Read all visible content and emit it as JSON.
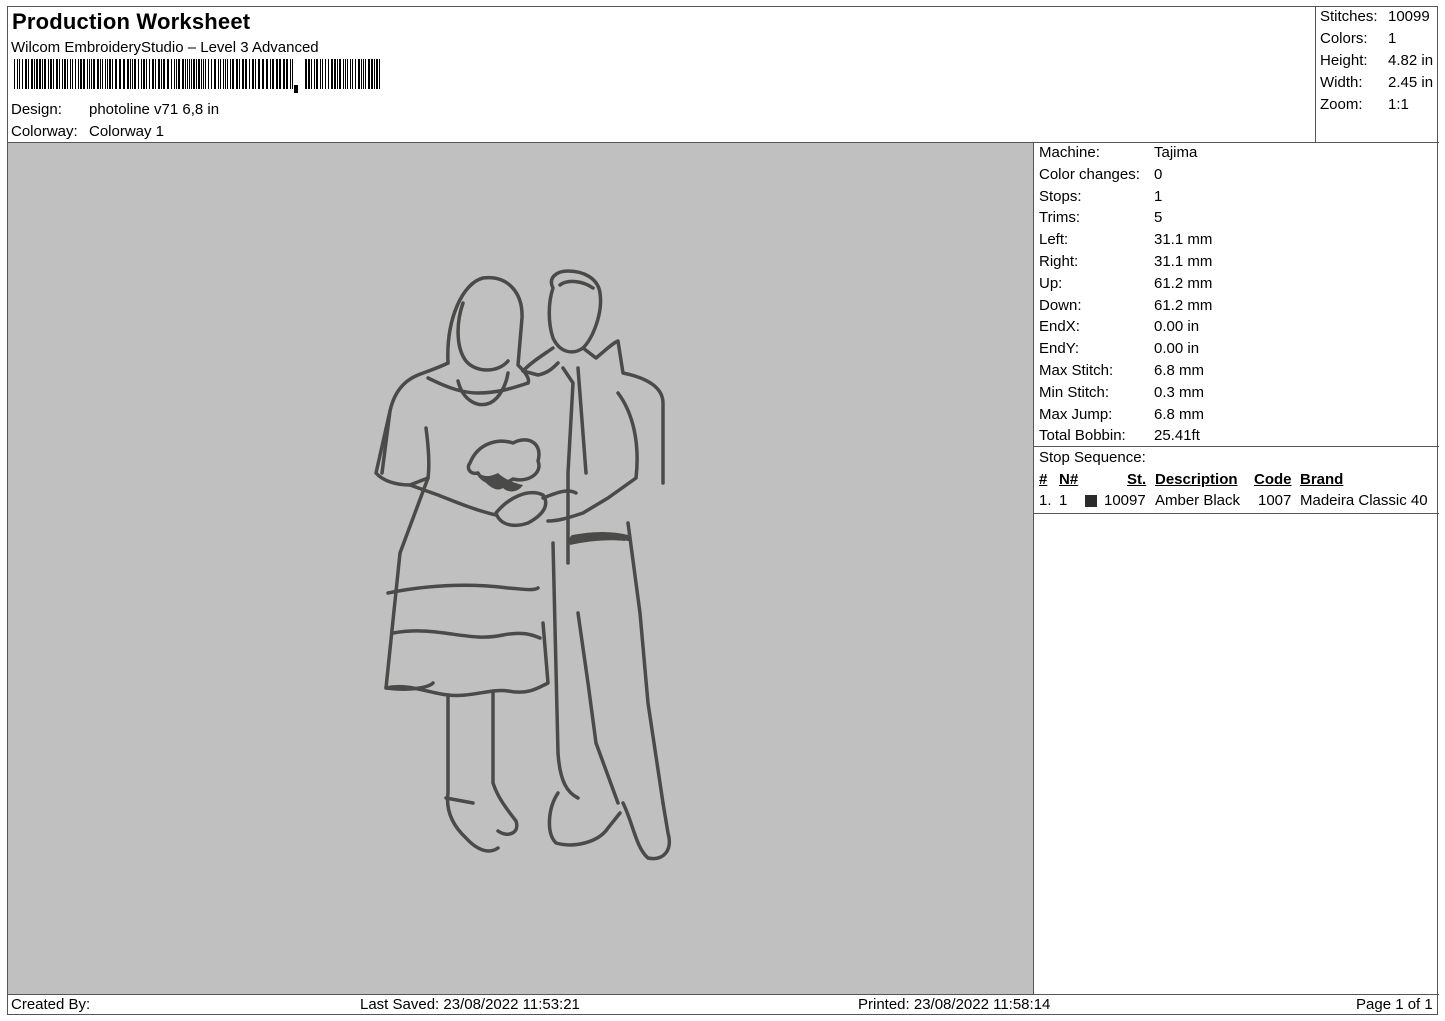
{
  "header": {
    "title": "Production Worksheet",
    "subtitle": "Wilcom EmbroideryStudio – Level 3 Advanced",
    "design_label": "Design:",
    "design_value": "photoline v71 6,8 in",
    "colorway_label": "Colorway:",
    "colorway_value": "Colorway 1"
  },
  "stats": [
    {
      "label": "Stitches:",
      "value": "10099"
    },
    {
      "label": "Colors:",
      "value": "1"
    },
    {
      "label": "Height:",
      "value": "4.82 in"
    },
    {
      "label": "Width:",
      "value": "2.45 in"
    },
    {
      "label": "Zoom:",
      "value": "1:1"
    }
  ],
  "machine_info": [
    {
      "label": "Machine:",
      "value": "Tajima"
    },
    {
      "label": "Color changes:",
      "value": "0"
    },
    {
      "label": "Stops:",
      "value": "1"
    },
    {
      "label": "Trims:",
      "value": "5"
    },
    {
      "label": "Left:",
      "value": "31.1 mm"
    },
    {
      "label": "Right:",
      "value": "31.1 mm"
    },
    {
      "label": "Up:",
      "value": "61.2 mm"
    },
    {
      "label": "Down:",
      "value": "61.2 mm"
    },
    {
      "label": "EndX:",
      "value": "0.00 in"
    },
    {
      "label": "EndY:",
      "value": "0.00 in"
    },
    {
      "label": "Max Stitch:",
      "value": "6.8 mm"
    },
    {
      "label": "Min Stitch:",
      "value": "0.3 mm"
    },
    {
      "label": "Max Jump:",
      "value": "6.8 mm"
    },
    {
      "label": "Total Bobbin:",
      "value": "25.41ft"
    }
  ],
  "stop_sequence": {
    "title": "Stop Sequence:",
    "columns": {
      "index": "#",
      "needle": "N#",
      "stitches": "St.",
      "description": "Description",
      "code": "Code",
      "brand": "Brand"
    },
    "rows": [
      {
        "index": "1.",
        "needle": "1",
        "swatch_color": "#2b2b2b",
        "stitches": "10097",
        "description": "Amber Black",
        "code": "1007",
        "brand": "Madeira Classic 40"
      }
    ]
  },
  "design_preview": {
    "background": "#c0c0c0",
    "thread_color": "#4a4a48",
    "icon": "embroidery-couple-outline"
  },
  "footer": {
    "created_by": "Created By:",
    "last_saved": "Last Saved: 23/08/2022 11:53:21",
    "printed": "Printed: 23/08/2022 11:58:14",
    "page": "Page 1 of 1"
  }
}
